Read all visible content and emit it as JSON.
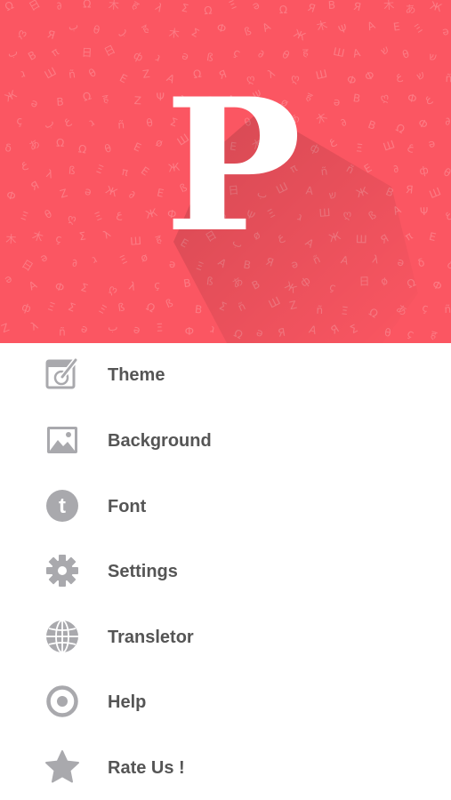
{
  "header": {
    "logo_letter": "P",
    "background_color": "#fb5662"
  },
  "menu": {
    "icon_color": "#a9a9ad",
    "text_color": "#555555",
    "items": [
      {
        "label": "Theme",
        "icon": "theme-palette-icon"
      },
      {
        "label": "Background",
        "icon": "image-icon"
      },
      {
        "label": "Font",
        "icon": "font-t-icon"
      },
      {
        "label": "Settings",
        "icon": "gear-icon"
      },
      {
        "label": "Transletor",
        "icon": "globe-icon"
      },
      {
        "label": "Help",
        "icon": "help-target-icon"
      },
      {
        "label": "Rate Us !",
        "icon": "star-icon"
      }
    ]
  }
}
